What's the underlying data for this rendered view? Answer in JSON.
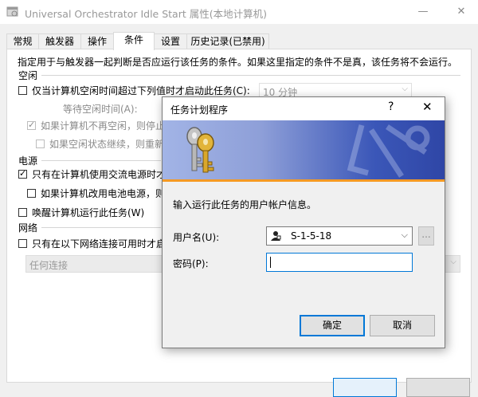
{
  "window": {
    "title": "Universal Orchestrator Idle Start 属性(本地计算机)",
    "minimize": "—",
    "close": "✕"
  },
  "tabs": [
    "常规",
    "触发器",
    "操作",
    "条件",
    "设置",
    "历史记录(已禁用)"
  ],
  "conditions": {
    "description": "指定用于与触发器一起判断是否应运行该任务的条件。如果这里指定的条件不是真，该任务将不会运行。",
    "idle_section": "空闲",
    "idle_start": "仅当计算机空闲时间超过下列值时才启动此任务(C):",
    "idle_duration": "10 分钟",
    "wait_idle": "等待空闲时间(A):",
    "stop_if_not_idle": "如果计算机不再空闲，则停止(",
    "restart_if_idle": "如果空闲状态继续，则重新启",
    "power_section": "电源",
    "ac_power": "只有在计算机使用交流电源时才启",
    "stop_on_battery": "如果计算机改用电池电源，则停",
    "wake": "唤醒计算机运行此任务(W)",
    "network_section": "网络",
    "network_only": "只有在以下网络连接可用时才启",
    "network_value": "任何连接"
  },
  "dialog": {
    "title": "任务计划程序",
    "help": "?",
    "close": "✕",
    "info": "输入运行此任务的用户帐户信息。",
    "user_label": "用户名(U):",
    "user_value": "S-1-5-18",
    "browse": "...",
    "password_label": "密码(P):",
    "ok": "确定",
    "cancel": "取消"
  },
  "colors": {
    "accent": "#0078d7",
    "banner_line": "#f59a23"
  }
}
